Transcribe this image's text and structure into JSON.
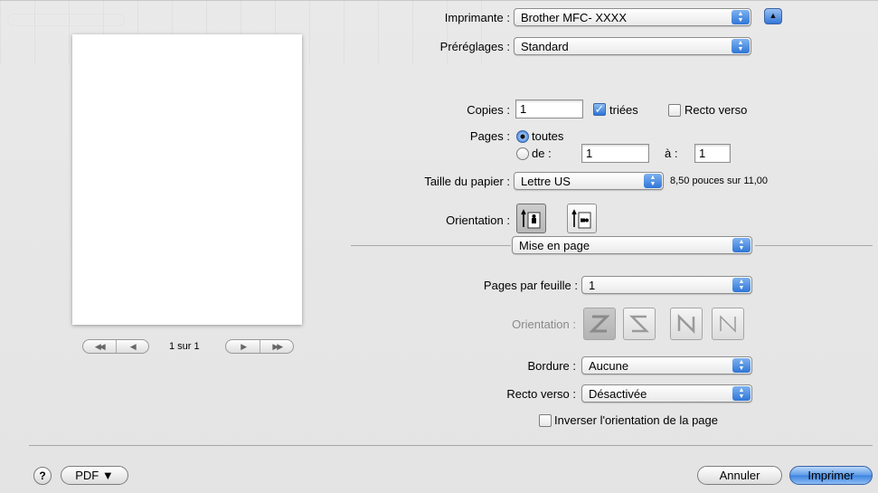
{
  "printer": {
    "label": "Imprimante :",
    "value": "Brother MFC- XXXX"
  },
  "presets": {
    "label": "Préréglages :",
    "value": "Standard"
  },
  "copies": {
    "label": "Copies :",
    "value": "1",
    "collated_label": "triées",
    "duplex_label": "Recto verso"
  },
  "pages": {
    "label": "Pages :",
    "all_label": "toutes",
    "from_label": "de :",
    "from_value": "1",
    "to_label": "à :",
    "to_value": "1"
  },
  "paper_size": {
    "label": "Taille du papier :",
    "value": "Lettre US",
    "dimensions": "8,50 pouces sur 11,00"
  },
  "orientation": {
    "label": "Orientation :"
  },
  "section_popup": {
    "value": "Mise en page"
  },
  "layout": {
    "pages_per_sheet_label": "Pages par feuille :",
    "pages_per_sheet_value": "1",
    "direction_label": "Orientation :",
    "border_label": "Bordure :",
    "border_value": "Aucune",
    "duplex_label": "Recto verso :",
    "duplex_value": "Désactivée",
    "reverse_label": "Inverser l'orientation de la page"
  },
  "preview": {
    "counter": "1 sur 1"
  },
  "footer": {
    "help": "?",
    "pdf_label": "PDF ▼",
    "cancel_label": "Annuler",
    "print_label": "Imprimer"
  },
  "colors": {
    "accent": "#3c82e0",
    "background": "#e8e8e8"
  }
}
